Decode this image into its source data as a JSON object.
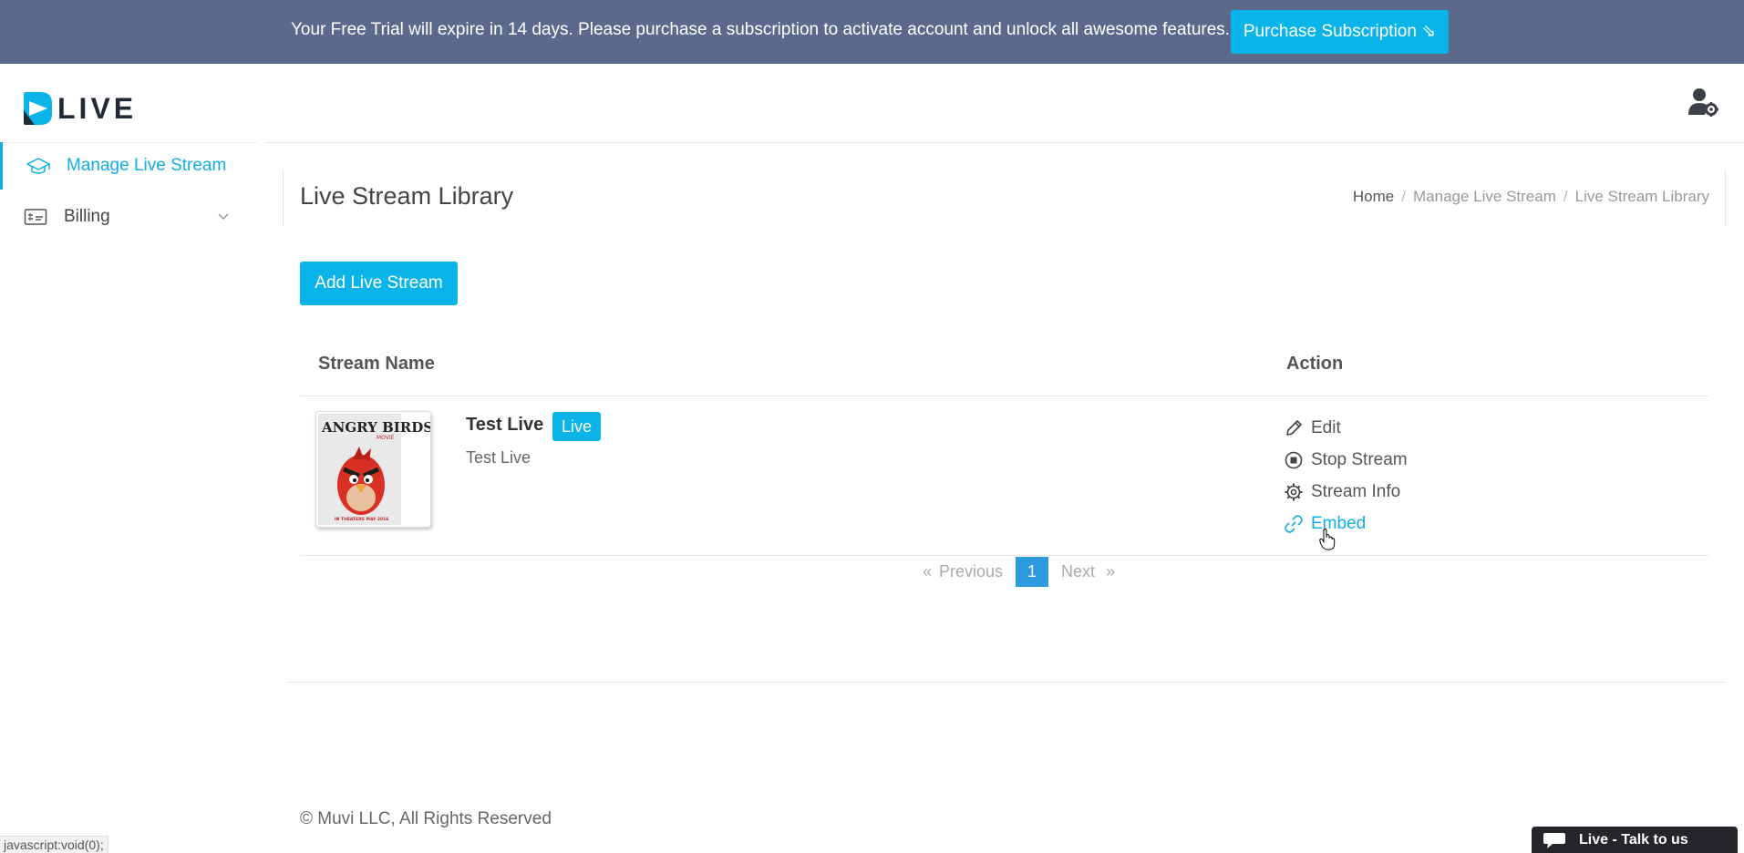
{
  "banner": {
    "message": "Your Free Trial will expire in 14 days. Please purchase a subscription to activate account and unlock all awesome features.",
    "button_label": "Purchase Subscription ⇘"
  },
  "header": {
    "logo_text": "LIVE",
    "user_icon": "user-settings-icon"
  },
  "sidebar": {
    "items": [
      {
        "label": "Manage Live Stream",
        "icon": "graduation-cap-icon",
        "active": true
      },
      {
        "label": "Billing",
        "icon": "billing-card-icon",
        "active": false
      }
    ]
  },
  "page": {
    "title": "Live Stream Library",
    "breadcrumb": [
      "Home",
      "Manage Live Stream",
      "Live Stream Library"
    ],
    "add_button": "Add Live Stream"
  },
  "table": {
    "columns": [
      "Stream Name",
      "Action"
    ],
    "rows": [
      {
        "name": "Test Live",
        "badge": "Live",
        "description": "Test Live",
        "thumbnail_title": "ANGRY BIRDS",
        "thumbnail_subtitle": "MOVIE",
        "thumbnail_caption": "IN THEATERS MAY 2016",
        "actions": [
          {
            "label": "Edit",
            "icon": "pencil-icon"
          },
          {
            "label": "Stop Stream",
            "icon": "stop-circle-icon"
          },
          {
            "label": "Stream Info",
            "icon": "gear-icon"
          },
          {
            "label": "Embed",
            "icon": "link-icon"
          }
        ]
      }
    ]
  },
  "pagination": {
    "prev_arrow": "«",
    "prev_label": "Previous",
    "current_page": "1",
    "next_label": "Next",
    "next_arrow": "»"
  },
  "footer": {
    "copyright": "© Muvi LLC, All Rights Reserved"
  },
  "status_bar": {
    "url": "javascript:void(0);"
  },
  "chat": {
    "label": "Live - Talk to us"
  },
  "colors": {
    "banner_bg": "#5b6a8c",
    "accent": "#0bb4e8",
    "pagination_active": "#2e9ae0"
  }
}
